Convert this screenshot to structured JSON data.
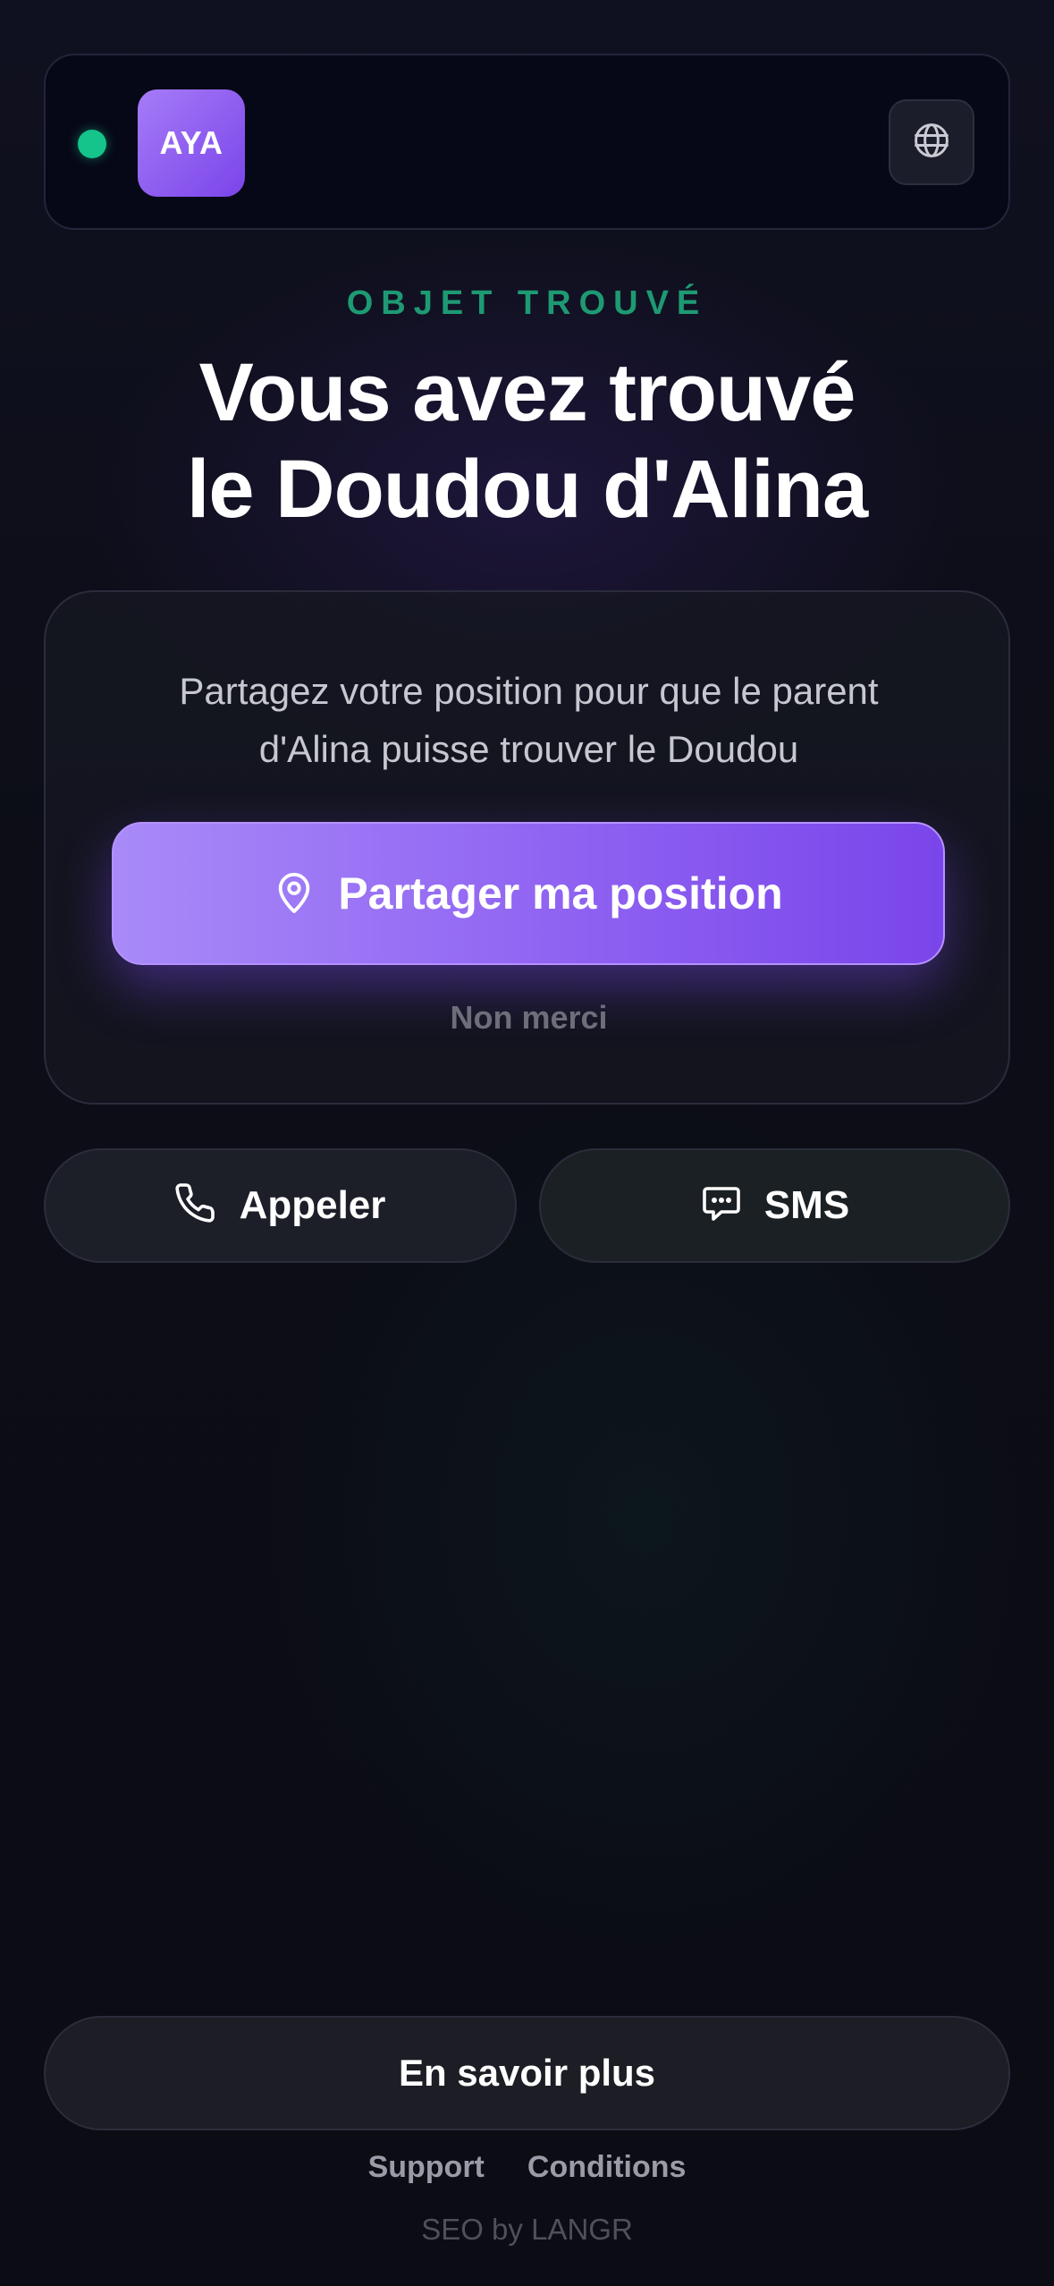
{
  "header": {
    "status": "online",
    "logo_text": "AYA",
    "language_icon": "globe-icon"
  },
  "hero": {
    "eyebrow": "OBJET TROUVÉ",
    "title_line1": "Vous avez trouvé",
    "title_line2": "le Doudou d'Alina"
  },
  "share_card": {
    "description_line1": "Partagez votre position pour que le parent",
    "description_line2": "d'Alina puisse trouver le Doudou",
    "share_button_label": "Partager ma position",
    "share_icon": "location-pin-icon",
    "decline_label": "Non merci"
  },
  "contact": {
    "call_label": "Appeler",
    "call_icon": "phone-icon",
    "sms_label": "SMS",
    "sms_icon": "chat-bubble-icon"
  },
  "footer": {
    "more_button_label": "En savoir plus",
    "links": [
      "Support",
      "Conditions"
    ],
    "credit": "SEO by LANGR"
  },
  "colors": {
    "accent_purple": "#8f62f2",
    "status_green": "#14c48a",
    "eyebrow_green": "#1e9a73",
    "background": "#0d0e17"
  }
}
